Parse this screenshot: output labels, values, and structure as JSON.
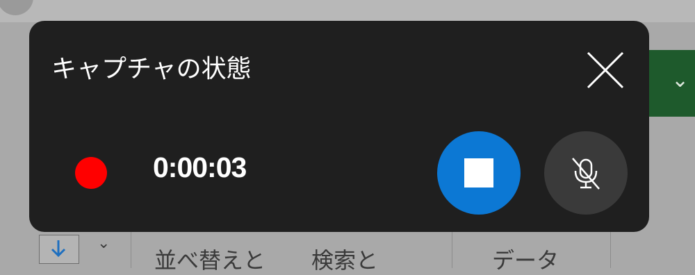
{
  "background_app": {
    "ribbon_texts": [
      "並べ替えと",
      "検索と",
      "データ"
    ]
  },
  "capture_panel": {
    "title": "キャプチャの状態",
    "elapsed_time": "0:00:03",
    "recording_indicator_color": "#ff0000",
    "stop_button_color": "#0c78d4",
    "icons": {
      "close": "close-icon",
      "stop": "stop-icon",
      "microphone": "microphone-muted-icon"
    }
  }
}
